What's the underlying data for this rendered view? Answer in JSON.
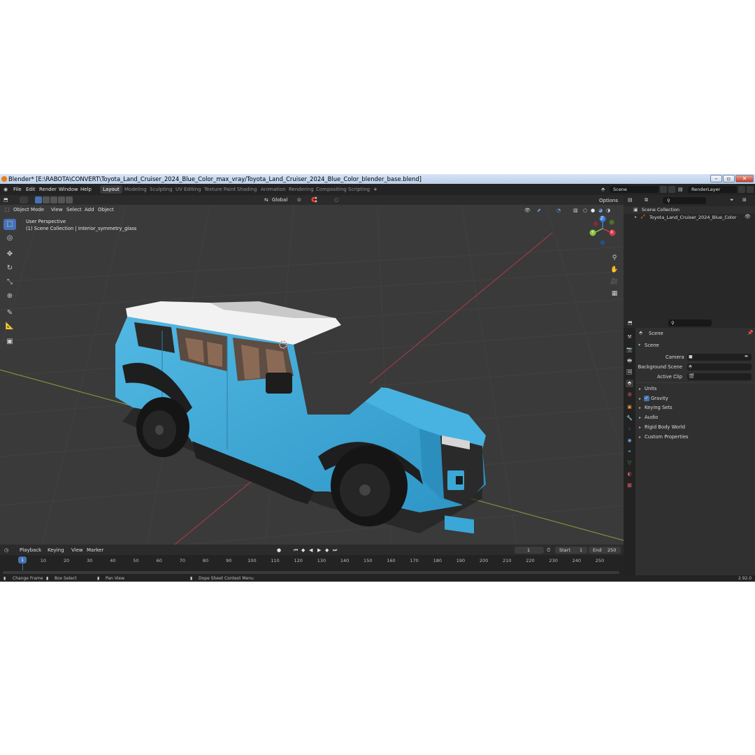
{
  "window": {
    "title": "Blender* [E:\\RABOTA\\CONVERT\\Toyota_Land_Cruiser_2024_Blue_Color_max_vray/Toyota_Land_Cruiser_2024_Blue_Color_blender_base.blend]"
  },
  "menu": [
    "File",
    "Edit",
    "Render",
    "Window",
    "Help"
  ],
  "workspaces": {
    "active": "Layout",
    "tabs": [
      "Layout",
      "Modeling",
      "Sculpting",
      "UV Editing",
      "Texture Paint",
      "Shading",
      "Animation",
      "Rendering",
      "Compositing",
      "Scripting"
    ],
    "add": "+"
  },
  "top_right": {
    "scene": "Scene",
    "view_layer": "RenderLayer"
  },
  "viewport_header": {
    "mode": "Object Mode",
    "menus": [
      "View",
      "Select",
      "Add",
      "Object"
    ],
    "orientation": "Global",
    "options": "Options"
  },
  "viewport": {
    "perspective": "User Perspective",
    "collection_info": "(1) Scene Collection | Interior_symmetry_glass",
    "gizmo": {
      "x": "X",
      "y": "Y",
      "z": "Z"
    }
  },
  "outliner": {
    "root": "Scene Collection",
    "items": [
      "Toyota_Land_Cruiser_2024_Blue_Color"
    ]
  },
  "properties": {
    "breadcrumb": "Scene",
    "section": "Scene",
    "fields": [
      {
        "label": "Camera"
      },
      {
        "label": "Background Scene"
      },
      {
        "label": "Active Clip"
      }
    ],
    "panels": [
      "Units",
      "Gravity",
      "Keying Sets",
      "Audio",
      "Rigid Body World",
      "Custom Properties"
    ],
    "gravity_checked": true
  },
  "timeline": {
    "menus": [
      "Playback",
      "Keying",
      "View",
      "Marker"
    ],
    "current_frame": "1",
    "start_label": "Start",
    "start": "1",
    "end_label": "End",
    "end": "250",
    "ticks": [
      "1",
      "10",
      "20",
      "30",
      "40",
      "50",
      "60",
      "70",
      "80",
      "90",
      "100",
      "110",
      "120",
      "130",
      "140",
      "150",
      "160",
      "170",
      "180",
      "190",
      "200",
      "210",
      "220",
      "230",
      "240",
      "250"
    ]
  },
  "statusbar": {
    "items": [
      "Change Frame",
      "Box Select",
      "Pan View",
      "Dope Sheet Context Menu"
    ],
    "version": "2.92.0"
  },
  "colors": {
    "car_body": "#3aa7d6",
    "roof": "#f2f2f2",
    "active_blue": "#4772b3",
    "x_axis": "#d8394b",
    "y_axis": "#8cc63f",
    "z_axis": "#3b7dd8"
  }
}
